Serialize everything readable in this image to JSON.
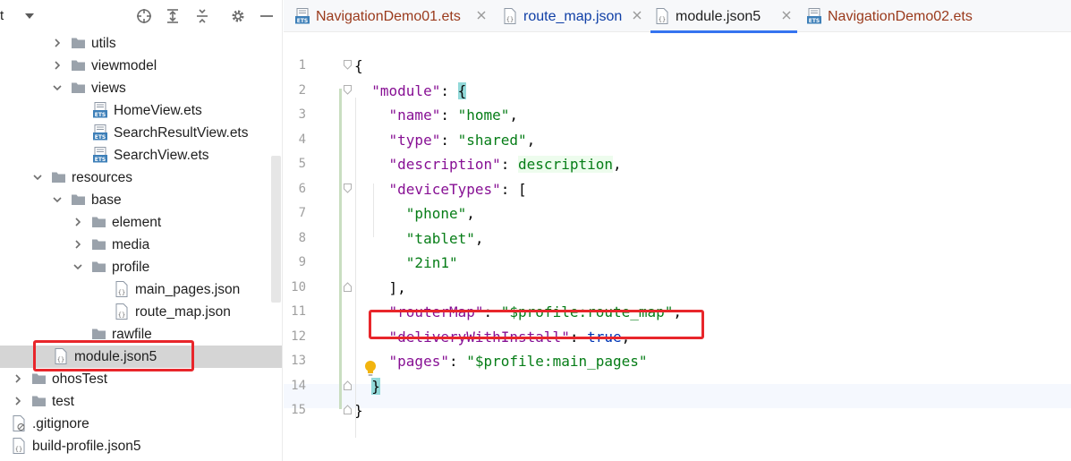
{
  "project_panel": {
    "partial_title": "t",
    "tree": [
      {
        "label": "utils",
        "type": "folder",
        "expanded": false
      },
      {
        "label": "viewmodel",
        "type": "folder",
        "expanded": false
      },
      {
        "label": "views",
        "type": "folder",
        "expanded": true
      },
      {
        "label": "HomeView.ets",
        "type": "ets-file"
      },
      {
        "label": "SearchResultView.ets",
        "type": "ets-file"
      },
      {
        "label": "SearchView.ets",
        "type": "ets-file"
      },
      {
        "label": "resources",
        "type": "folder",
        "expanded": true
      },
      {
        "label": "base",
        "type": "folder",
        "expanded": true
      },
      {
        "label": "element",
        "type": "folder",
        "expanded": false
      },
      {
        "label": "media",
        "type": "folder",
        "expanded": false
      },
      {
        "label": "profile",
        "type": "folder",
        "expanded": true
      },
      {
        "label": "main_pages.json",
        "type": "json-file"
      },
      {
        "label": "route_map.json",
        "type": "json-file"
      },
      {
        "label": "rawfile",
        "type": "folder"
      },
      {
        "label": "module.json5",
        "type": "json-file",
        "selected": true
      },
      {
        "label": "ohosTest",
        "type": "folder",
        "expanded": false
      },
      {
        "label": "test",
        "type": "folder",
        "expanded": false
      },
      {
        "label": ".gitignore",
        "type": "ignore-file"
      },
      {
        "label": "build-profile.json5",
        "type": "json-file"
      }
    ]
  },
  "tabs": [
    {
      "label": "NavigationDemo01.ets",
      "icon": "ets-file-icon",
      "active": false
    },
    {
      "label": "route_map.json",
      "icon": "json-file-icon",
      "active": false
    },
    {
      "label": "module.json5",
      "icon": "json-file-icon",
      "active": true
    },
    {
      "label": "NavigationDemo02.ets",
      "icon": "ets-file-icon",
      "active": false
    }
  ],
  "editor": {
    "current_line": 14,
    "lines": [
      {
        "n": "1",
        "parts": [
          {
            "t": "{",
            "c": "p"
          }
        ]
      },
      {
        "n": "2",
        "parts": [
          {
            "t": "  ",
            "c": "p"
          },
          {
            "t": "\"module\"",
            "c": "k"
          },
          {
            "t": ": ",
            "c": "p"
          },
          {
            "t": "{",
            "c": "brace-match"
          }
        ]
      },
      {
        "n": "3",
        "parts": [
          {
            "t": "    ",
            "c": "p"
          },
          {
            "t": "\"name\"",
            "c": "k"
          },
          {
            "t": ": ",
            "c": "p"
          },
          {
            "t": "\"home\"",
            "c": "s"
          },
          {
            "t": ",",
            "c": "p"
          }
        ]
      },
      {
        "n": "4",
        "parts": [
          {
            "t": "    ",
            "c": "p"
          },
          {
            "t": "\"type\"",
            "c": "k"
          },
          {
            "t": ": ",
            "c": "p"
          },
          {
            "t": "\"shared\"",
            "c": "s"
          },
          {
            "t": ",",
            "c": "p"
          }
        ]
      },
      {
        "n": "5",
        "parts": [
          {
            "t": "    ",
            "c": "p"
          },
          {
            "t": "\"description\"",
            "c": "k"
          },
          {
            "t": ": ",
            "c": "p"
          },
          {
            "t": "description",
            "c": "hl-val"
          },
          {
            "t": ",",
            "c": "p"
          }
        ]
      },
      {
        "n": "6",
        "parts": [
          {
            "t": "    ",
            "c": "p"
          },
          {
            "t": "\"deviceTypes\"",
            "c": "k"
          },
          {
            "t": ": [",
            "c": "p"
          }
        ]
      },
      {
        "n": "7",
        "parts": [
          {
            "t": "      ",
            "c": "p"
          },
          {
            "t": "\"phone\"",
            "c": "s"
          },
          {
            "t": ",",
            "c": "p"
          }
        ]
      },
      {
        "n": "8",
        "parts": [
          {
            "t": "      ",
            "c": "p"
          },
          {
            "t": "\"tablet\"",
            "c": "s"
          },
          {
            "t": ",",
            "c": "p"
          }
        ]
      },
      {
        "n": "9",
        "parts": [
          {
            "t": "      ",
            "c": "p"
          },
          {
            "t": "\"2in1\"",
            "c": "s"
          }
        ]
      },
      {
        "n": "10",
        "parts": [
          {
            "t": "    ],",
            "c": "p"
          }
        ]
      },
      {
        "n": "11",
        "parts": [
          {
            "t": "    ",
            "c": "p"
          },
          {
            "t": "\"routerMap\"",
            "c": "k"
          },
          {
            "t": ": ",
            "c": "p"
          },
          {
            "t": "\"$profile:route_map\"",
            "c": "s"
          },
          {
            "t": ",",
            "c": "p"
          }
        ]
      },
      {
        "n": "12",
        "parts": [
          {
            "t": "    ",
            "c": "p"
          },
          {
            "t": "\"deliveryWithInstall\"",
            "c": "k"
          },
          {
            "t": ": ",
            "c": "p"
          },
          {
            "t": "true",
            "c": "kw"
          },
          {
            "t": ",",
            "c": "p"
          }
        ]
      },
      {
        "n": "13",
        "parts": [
          {
            "t": "    ",
            "c": "p"
          },
          {
            "t": "\"pages\"",
            "c": "k"
          },
          {
            "t": ": ",
            "c": "p"
          },
          {
            "t": "\"$profile:main_pages\"",
            "c": "s"
          }
        ]
      },
      {
        "n": "14",
        "parts": [
          {
            "t": "  ",
            "c": "p"
          },
          {
            "t": "}",
            "c": "brace-match"
          }
        ]
      },
      {
        "n": "15",
        "parts": [
          {
            "t": "}",
            "c": "p"
          }
        ]
      }
    ]
  },
  "colors": {
    "accent": "#3574f0",
    "highlight_red": "#e8262b",
    "json_key": "#871094",
    "json_string": "#067d17",
    "keyword": "#0033b3"
  }
}
